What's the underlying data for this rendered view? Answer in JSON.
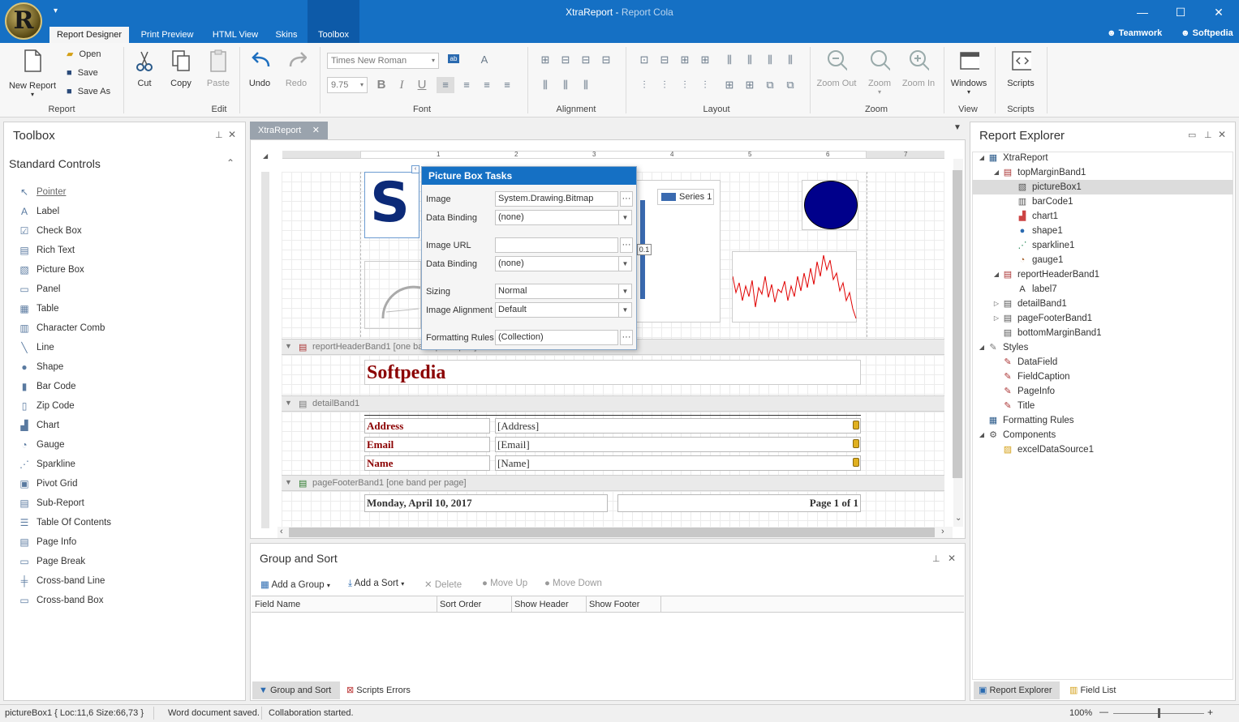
{
  "app": {
    "title": "XtraReport",
    "subtitle": "Report Cola",
    "logo_letter": "R"
  },
  "tabs": [
    "Report Designer",
    "Print Preview",
    "HTML View",
    "Skins",
    "Toolbox"
  ],
  "brands": {
    "teamwork": "Teamwork",
    "softpedia": "Softpedia"
  },
  "ribbon": {
    "report": {
      "new_report": "New Report",
      "open": "Open",
      "save": "Save",
      "save_as": "Save As",
      "group": "Report"
    },
    "edit": {
      "cut": "Cut",
      "copy": "Copy",
      "paste": "Paste",
      "undo": "Undo",
      "redo": "Redo",
      "group": "Edit"
    },
    "font": {
      "family": "Times New Roman",
      "size": "9.75",
      "group": "Font"
    },
    "alignment_group": "Alignment",
    "layout_group": "Layout",
    "zoom": {
      "zoom_out": "Zoom Out",
      "zoom": "Zoom",
      "zoom_in": "Zoom In",
      "group": "Zoom"
    },
    "view": {
      "windows": "Windows",
      "group": "View"
    },
    "scripts": {
      "scripts": "Scripts",
      "group": "Scripts"
    }
  },
  "toolbox": {
    "title": "Toolbox",
    "section": "Standard Controls",
    "items": [
      "Pointer",
      "Label",
      "Check Box",
      "Rich Text",
      "Picture Box",
      "Panel",
      "Table",
      "Character Comb",
      "Line",
      "Shape",
      "Bar Code",
      "Zip Code",
      "Chart",
      "Gauge",
      "Sparkline",
      "Pivot Grid",
      "Sub-Report",
      "Table Of Contents",
      "Page Info",
      "Page Break",
      "Cross-band Line",
      "Cross-band Box"
    ]
  },
  "doc_tab": "XtraReport",
  "bands": {
    "report_header": "reportHeaderBand1 [one band per report]",
    "detail": "detailBand1",
    "page_footer": "pageFooterBand1 [one band per page]"
  },
  "report": {
    "title_text": "Softpedia",
    "series": "Series 1",
    "rows": [
      {
        "label": "Address",
        "value": "[Address]"
      },
      {
        "label": "Email",
        "value": "[Email]"
      },
      {
        "label": "Name",
        "value": "[Name]"
      }
    ],
    "footer_date": "Monday, April 10, 2017",
    "footer_page": "Page 1 of 1",
    "chart_tag": "0.1"
  },
  "tasks": {
    "title": "Picture Box Tasks",
    "image_label": "Image",
    "image_value": "System.Drawing.Bitmap",
    "binding1_label": "Data Binding",
    "binding1_value": "(none)",
    "url_label": "Image URL",
    "url_value": "",
    "binding2_label": "Data Binding",
    "binding2_value": "(none)",
    "sizing_label": "Sizing",
    "sizing_value": "Normal",
    "align_label": "Image Alignment",
    "align_value": "Default",
    "rules_label": "Formatting Rules",
    "rules_value": "(Collection)"
  },
  "group_sort": {
    "title": "Group and Sort",
    "add_group": "Add a Group",
    "add_sort": "Add a Sort",
    "delete": "Delete",
    "move_up": "Move Up",
    "move_down": "Move Down",
    "columns": [
      "Field Name",
      "Sort Order",
      "Show Header",
      "Show Footer"
    ]
  },
  "bottom_tabs": {
    "group_sort": "Group and Sort",
    "scripts_errors": "Scripts Errors"
  },
  "explorer": {
    "title": "Report Explorer",
    "items": [
      "XtraReport",
      "topMarginBand1",
      "pictureBox1",
      "barCode1",
      "chart1",
      "shape1",
      "sparkline1",
      "gauge1",
      "reportHeaderBand1",
      "label7",
      "detailBand1",
      "pageFooterBand1",
      "bottomMarginBand1",
      "Styles",
      "DataField",
      "FieldCaption",
      "PageInfo",
      "Title",
      "Formatting Rules",
      "Components",
      "excelDataSource1"
    ],
    "tab_explorer": "Report Explorer",
    "tab_field_list": "Field List"
  },
  "status": {
    "selection": "pictureBox1 { Loc:11,6 Size:66,73 }",
    "msg1": "Word document saved.",
    "msg2": "Collaboration started.",
    "zoom": "100%"
  },
  "ruler_numbers": [
    "1",
    "2",
    "3",
    "4",
    "5",
    "6",
    "7"
  ]
}
